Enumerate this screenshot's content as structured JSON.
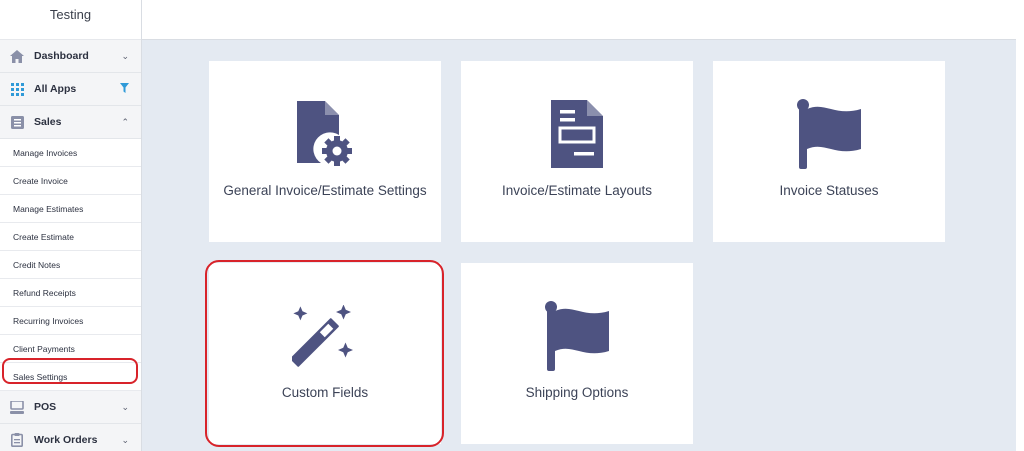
{
  "sidebar": {
    "brand": "Testing",
    "items": [
      {
        "label": "Dashboard"
      },
      {
        "label": "All Apps"
      },
      {
        "label": "Sales"
      }
    ],
    "sales_sub": [
      "Manage Invoices",
      "Create Invoice",
      "Manage Estimates",
      "Create Estimate",
      "Credit Notes",
      "Refund Receipts",
      "Recurring Invoices",
      "Client Payments",
      "Sales Settings"
    ],
    "bottom_items": [
      {
        "label": "POS"
      },
      {
        "label": "Work Orders"
      }
    ]
  },
  "cards": [
    {
      "label": "General Invoice/Estimate Settings",
      "icon": "file-gear-icon"
    },
    {
      "label": "Invoice/Estimate Layouts",
      "icon": "document-layout-icon"
    },
    {
      "label": "Invoice Statuses",
      "icon": "flag-icon"
    },
    {
      "label": "Custom Fields",
      "icon": "magic-wand-icon"
    },
    {
      "label": "Shipping Options",
      "icon": "flag-icon"
    }
  ],
  "colors": {
    "icon": "#4e5381",
    "highlight": "#d8232a",
    "filter": "#2f9ad8"
  }
}
